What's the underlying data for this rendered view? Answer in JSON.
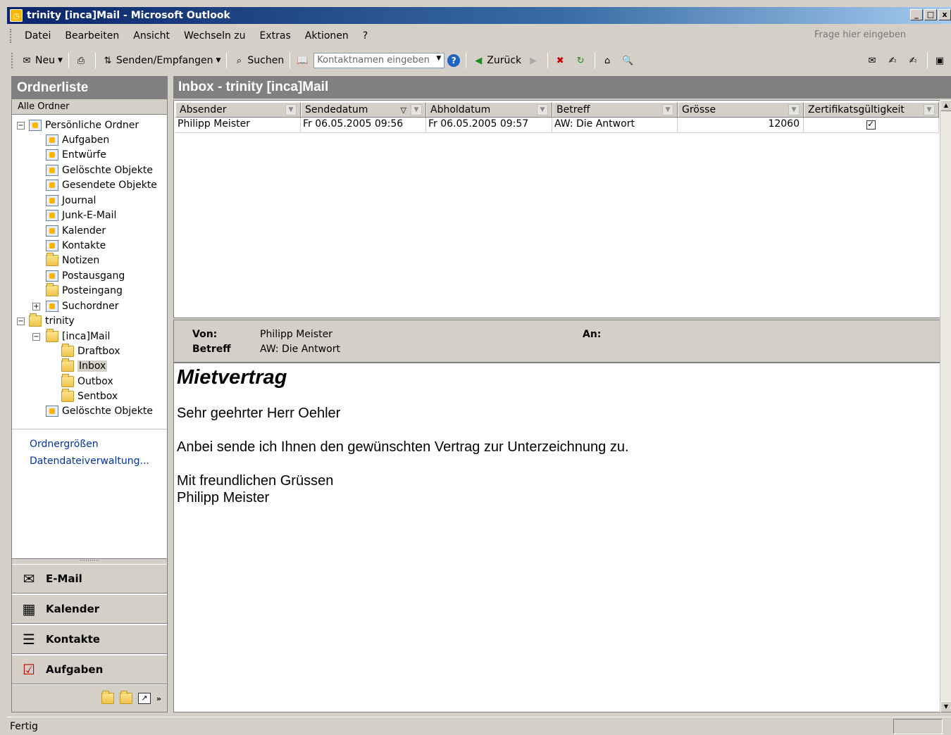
{
  "window": {
    "title": "trinity [inca]Mail - Microsoft Outlook"
  },
  "menu": {
    "items": [
      "Datei",
      "Bearbeiten",
      "Ansicht",
      "Wechseln zu",
      "Extras",
      "Aktionen",
      "?"
    ],
    "ask_placeholder": "Frage hier eingeben"
  },
  "toolbar": {
    "new_label": "Neu",
    "send_receive_label": "Senden/Empfangen",
    "search_label": "Suchen",
    "contact_placeholder": "Kontaktnamen eingeben",
    "back_label": "Zurück"
  },
  "nav": {
    "title": "Ordnerliste",
    "subheader": "Alle Ordner",
    "personal_root": "Persönliche Ordner",
    "personal_folders": [
      "Aufgaben",
      "Entwürfe",
      "Gelöschte Objekte",
      "Gesendete Objekte",
      "Journal",
      "Junk-E-Mail",
      "Kalender",
      "Kontakte",
      "Notizen",
      "Postausgang",
      "Posteingang",
      "Suchordner"
    ],
    "trinity_root": "trinity",
    "inca_root": "[inca]Mail",
    "inca_folders": [
      "Draftbox",
      "Inbox",
      "Outbox",
      "Sentbox"
    ],
    "trinity_deleted": "Gelöschte Objekte",
    "links": [
      "Ordnergrößen",
      "Datendateiverwaltung..."
    ],
    "buttons": [
      "E-Mail",
      "Kalender",
      "Kontakte",
      "Aufgaben"
    ]
  },
  "main": {
    "title": "Inbox - trinity [inca]Mail",
    "columns": [
      "Absender",
      "Sendedatum",
      "Abholdatum",
      "Betreff",
      "Grösse",
      "Zertifikatsgültigkeit"
    ],
    "row": {
      "sender": "Philipp Meister",
      "sent": "Fr 06.05.2005 09:56",
      "received": "Fr 06.05.2005 09:57",
      "subject": "AW: Die Antwort",
      "size": "12060",
      "certificate_valid": true
    }
  },
  "reading": {
    "from_label": "Von:",
    "from_value": "Philipp Meister",
    "subject_label": "Betreff",
    "subject_value": "AW: Die Antwort",
    "to_label": "An:"
  },
  "message": {
    "title": "Mietvertrag",
    "greeting": "Sehr geehrter Herr Oehler",
    "body": "Anbei sende ich Ihnen den gewünschten Vertrag zur Unterzeichnung zu.",
    "closing": "Mit freundlichen Grüssen",
    "signature": "Philipp Meister"
  },
  "status": {
    "text": "Fertig"
  },
  "colors": {
    "title_bar": "#0a246a",
    "pane_header": "#808080",
    "link": "#0033aa"
  }
}
